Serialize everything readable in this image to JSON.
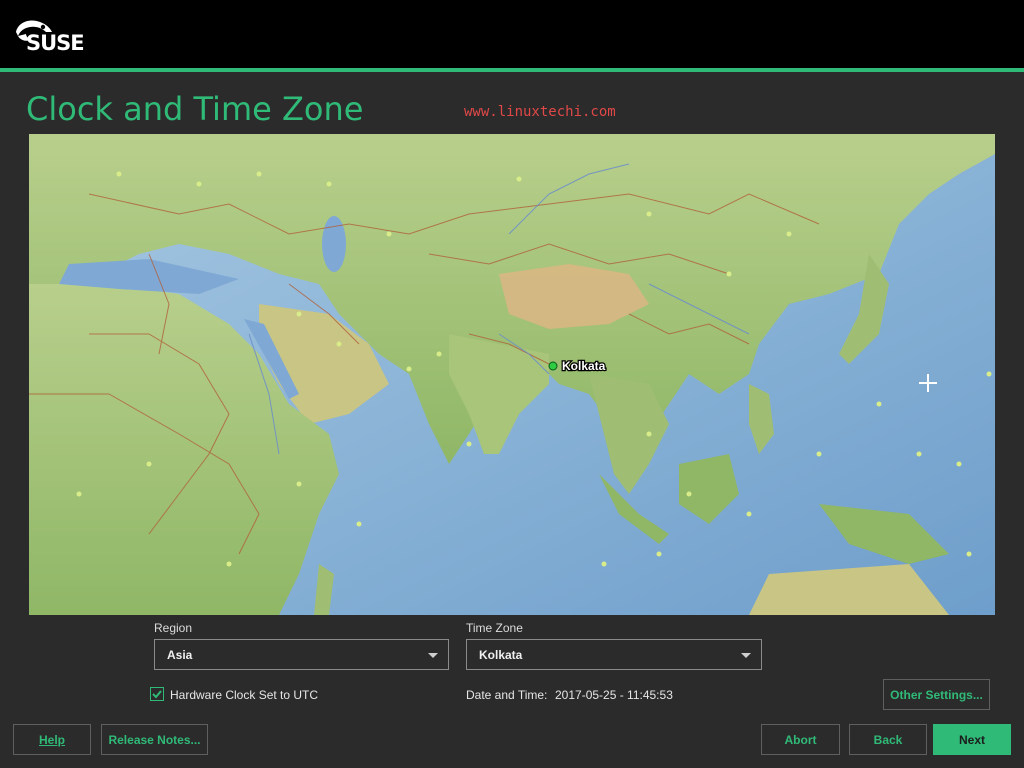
{
  "brand": {
    "logo_text": "SUSE"
  },
  "page": {
    "title": "Clock and Time Zone",
    "watermark": "www.linuxtechi.com"
  },
  "map": {
    "selected_city": "Kolkata",
    "colors": {
      "ocean": "#8fb8d8",
      "land": "#9fc07a",
      "highland": "#d6b27a",
      "border": "#b0603a",
      "marker": "#2ecc40"
    }
  },
  "region": {
    "label": "Region",
    "value": "Asia"
  },
  "timezone": {
    "label": "Time Zone",
    "value": "Kolkata"
  },
  "hw_clock": {
    "label": "Hardware Clock Set to UTC",
    "checked": true
  },
  "datetime": {
    "label": "Date and Time:",
    "value": "2017-05-25 - 11:45:53"
  },
  "buttons": {
    "other_settings": "Other Settings...",
    "help": "Help",
    "release_notes": "Release Notes...",
    "abort": "Abort",
    "back": "Back",
    "next": "Next"
  },
  "accent_color": "#30ba78"
}
